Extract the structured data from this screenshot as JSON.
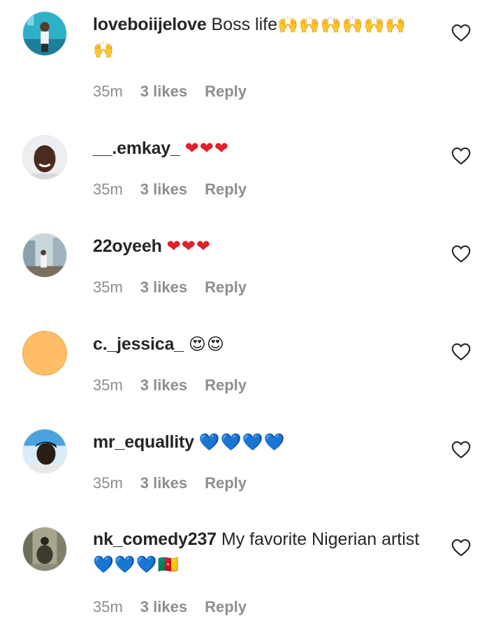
{
  "comments": [
    {
      "username": "loveboiijelove",
      "text": "Boss life",
      "emojis": "🙌🙌🙌🙌🙌🙌🙌",
      "time": "35m",
      "likes": "3 likes",
      "reply": "Reply",
      "avatar_color": "#2fb0c9"
    },
    {
      "username": "__.emkay_",
      "text": "",
      "emojis": "❤❤❤",
      "time": "35m",
      "likes": "3 likes",
      "reply": "Reply",
      "avatar_color": "#e9e9ee"
    },
    {
      "username": "22oyeeh",
      "text": "",
      "emojis": "❤❤❤",
      "time": "35m",
      "likes": "3 likes",
      "reply": "Reply",
      "avatar_color": "#b7c7cf"
    },
    {
      "username": "c._jessica_",
      "text": "",
      "emojis": "😍😍",
      "time": "35m",
      "likes": "3 likes",
      "reply": "Reply",
      "avatar_color": "#ffbd66"
    },
    {
      "username": "mr_equallity",
      "text": "",
      "emojis": "💙💙💙💙",
      "time": "35m",
      "likes": "3 likes",
      "reply": "Reply",
      "avatar_color": "#3f8fd0"
    },
    {
      "username": "nk_comedy237",
      "text": "My favorite Nigerian artist",
      "emojis": "💙💙💙🇨🇲",
      "time": "35m",
      "likes": "3 likes",
      "reply": "Reply",
      "avatar_color": "#6b6e5a"
    }
  ],
  "colors": {
    "text": "#262626",
    "meta": "#8e8e8e",
    "heart_red": "#e0202c",
    "heart_blue": "#1e8ff0"
  },
  "icons": {
    "like": "heart-outline-icon"
  }
}
